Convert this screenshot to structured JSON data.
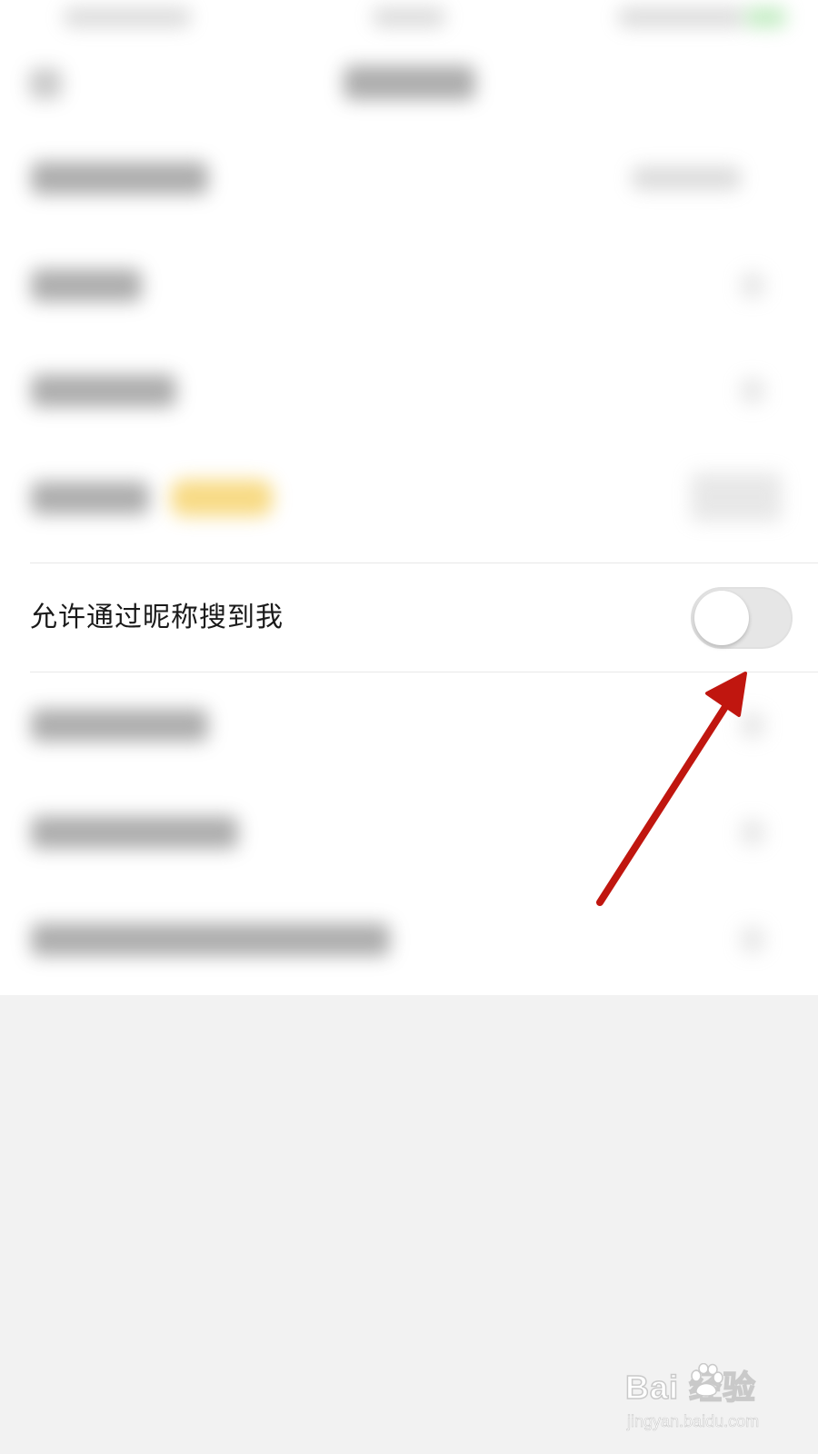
{
  "setting_row": {
    "label": "允许通过昵称搜到我",
    "toggle_on": false
  },
  "colors": {
    "annotation_arrow": "#c0160f",
    "toggle_track_off": "#e6e6e6",
    "page_background": "#f2f2f2"
  },
  "watermark": {
    "brand": "Bai  经验",
    "url": "jingyan.baidu.com"
  }
}
